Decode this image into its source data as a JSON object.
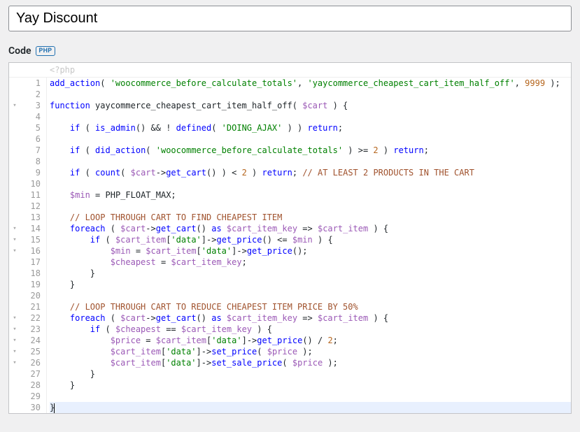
{
  "title": {
    "value": "Yay Discount"
  },
  "header": {
    "label": "Code",
    "badge": "PHP"
  },
  "phptag": "<?php",
  "fold": {
    "marks": {
      "3": "▾",
      "14": "▾",
      "15": "▾",
      "16": "▾",
      "22": "▾",
      "23": "▾",
      "24": "▾",
      "25": "▾",
      "26": "▾"
    }
  },
  "code": {
    "l1": {
      "fn1": "add_action",
      "p1": "( ",
      "s1": "'woocommerce_before_calculate_totals'",
      "c1": ", ",
      "s2": "'yaycommerce_cheapest_cart_item_half_off'",
      "c2": ", ",
      "n1": "9999",
      "p2": " );"
    },
    "l3": {
      "kw": "function",
      "name": " yaycommerce_cheapest_cart_item_half_off( ",
      "var": "$cart",
      "tail": " ) {"
    },
    "l5": {
      "ind": "    ",
      "kw": "if",
      "p1": " ( ",
      "fn1": "is_admin",
      "p2": "() && ! ",
      "fn2": "defined",
      "p3": "( ",
      "s1": "'DOING_AJAX'",
      "p4": " ) ) ",
      "kw2": "return",
      "p5": ";"
    },
    "l7": {
      "ind": "    ",
      "kw": "if",
      "p1": " ( ",
      "fn1": "did_action",
      "p2": "( ",
      "s1": "'woocommerce_before_calculate_totals'",
      "p3": " ) >= ",
      "n1": "2",
      "p4": " ) ",
      "kw2": "return",
      "p5": ";"
    },
    "l9": {
      "ind": "    ",
      "kw": "if",
      "p1": " ( ",
      "fn1": "count",
      "p2": "( ",
      "var": "$cart",
      "p3": "->",
      "fn2": "get_cart",
      "p4": "() ) < ",
      "n1": "2",
      "p5": " ) ",
      "kw2": "return",
      "p6": "; ",
      "cm": "// AT LEAST 2 PRODUCTS IN THE CART"
    },
    "l11": {
      "ind": "    ",
      "var": "$min",
      "p1": " = ",
      "cn": "PHP_FLOAT_MAX",
      "p2": ";"
    },
    "l13": {
      "ind": "    ",
      "cm": "// LOOP THROUGH CART TO FIND CHEAPEST ITEM"
    },
    "l14": {
      "ind": "    ",
      "kw": "foreach",
      "p1": " ( ",
      "var1": "$cart",
      "p2": "->",
      "fn1": "get_cart",
      "p3": "() ",
      "kw2": "as",
      "p4": " ",
      "var2": "$cart_item_key",
      "p5": " => ",
      "var3": "$cart_item",
      "p6": " ) {"
    },
    "l15": {
      "ind": "        ",
      "kw": "if",
      "p1": " ( ",
      "var1": "$cart_item",
      "p2": "[",
      "s1": "'data'",
      "p3": "]->",
      "fn1": "get_price",
      "p4": "() <= ",
      "var2": "$min",
      "p5": " ) {"
    },
    "l16": {
      "ind": "            ",
      "var1": "$min",
      "p1": " = ",
      "var2": "$cart_item",
      "p2": "[",
      "s1": "'data'",
      "p3": "]->",
      "fn1": "get_price",
      "p4": "();"
    },
    "l17": {
      "ind": "            ",
      "var1": "$cheapest",
      "p1": " = ",
      "var2": "$cart_item_key",
      "p2": ";"
    },
    "l18": {
      "txt": "        }"
    },
    "l19": {
      "txt": "    }"
    },
    "l21": {
      "ind": "    ",
      "cm": "// LOOP THROUGH CART TO REDUCE CHEAPEST ITEM PRICE BY 50%"
    },
    "l22": {
      "ind": "    ",
      "kw": "foreach",
      "p1": " ( ",
      "var1": "$cart",
      "p2": "->",
      "fn1": "get_cart",
      "p3": "() ",
      "kw2": "as",
      "p4": " ",
      "var2": "$cart_item_key",
      "p5": " => ",
      "var3": "$cart_item",
      "p6": " ) {"
    },
    "l23": {
      "ind": "        ",
      "kw": "if",
      "p1": " ( ",
      "var1": "$cheapest",
      "p2": " == ",
      "var2": "$cart_item_key",
      "p3": " ) {"
    },
    "l24": {
      "ind": "            ",
      "var1": "$price",
      "p1": " = ",
      "var2": "$cart_item",
      "p2": "[",
      "s1": "'data'",
      "p3": "]->",
      "fn1": "get_price",
      "p4": "() / ",
      "n1": "2",
      "p5": ";"
    },
    "l25": {
      "ind": "            ",
      "var1": "$cart_item",
      "p1": "[",
      "s1": "'data'",
      "p2": "]->",
      "fn1": "set_price",
      "p3": "( ",
      "var2": "$price",
      "p4": " );"
    },
    "l26": {
      "ind": "            ",
      "var1": "$cart_item",
      "p1": "[",
      "s1": "'data'",
      "p2": "]->",
      "fn1": "set_sale_price",
      "p3": "( ",
      "var2": "$price",
      "p4": " );"
    },
    "l27": {
      "txt": "        }"
    },
    "l28": {
      "txt": "    }"
    },
    "l30": {
      "txt": "}"
    }
  }
}
